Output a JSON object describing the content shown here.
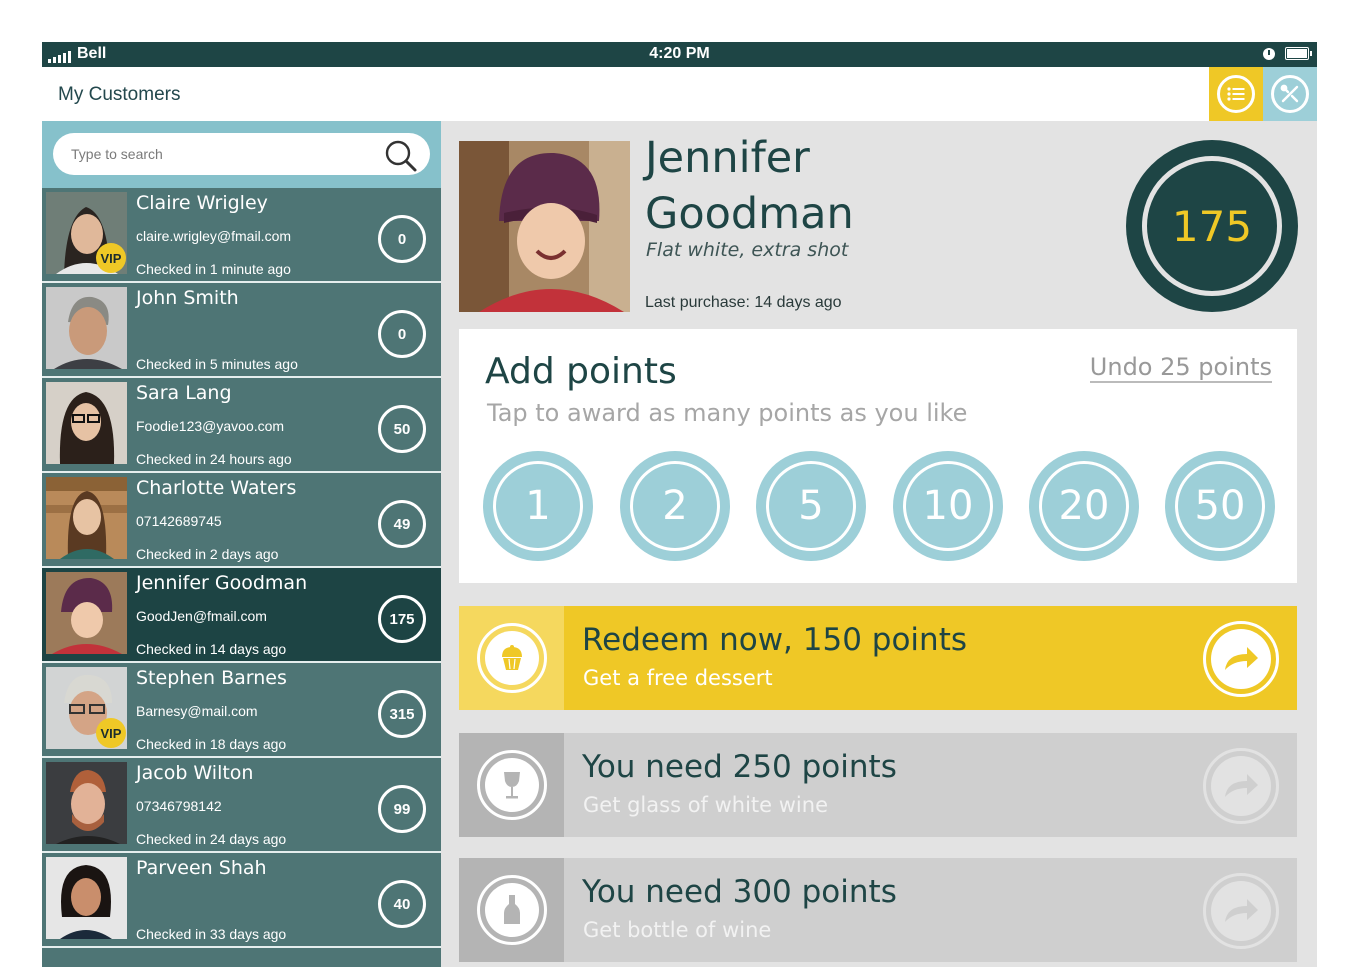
{
  "status_bar": {
    "carrier": "Bell",
    "time": "4:20 PM"
  },
  "nav": {
    "title": "My Customers",
    "list_icon": "list-icon",
    "tools_icon": "tools-icon"
  },
  "search": {
    "placeholder": "Type to search",
    "icon": "search-icon"
  },
  "customers": [
    {
      "name": "Claire Wrigley",
      "contact": "claire.wrigley@fmail.com",
      "checked": "Checked in 1 minute ago",
      "points": "0",
      "vip": "VIP"
    },
    {
      "name": "John Smith",
      "contact": "",
      "checked": "Checked in 5 minutes ago",
      "points": "0"
    },
    {
      "name": "Sara Lang",
      "contact": "Foodie123@yavoo.com",
      "checked": "Checked in 24 hours ago",
      "points": "50"
    },
    {
      "name": "Charlotte Waters",
      "contact": "07142689745",
      "checked": "Checked in 2 days ago",
      "points": "49"
    },
    {
      "name": "Jennifer Goodman",
      "contact": "GoodJen@fmail.com",
      "checked": "Checked in 14 days ago",
      "points": "175",
      "active": true
    },
    {
      "name": "Stephen Barnes",
      "contact": "Barnesy@mail.com",
      "checked": "Checked in 18 days ago",
      "points": "315",
      "vip": "VIP"
    },
    {
      "name": "Jacob Wilton",
      "contact": "07346798142",
      "checked": "Checked in 24 days ago",
      "points": "99"
    },
    {
      "name": "Parveen Shah",
      "contact": "",
      "checked": "Checked in 33 days ago",
      "points": "40"
    }
  ],
  "profile": {
    "first_name": "Jennifer",
    "last_name": "Goodman",
    "note": "Flat white, extra shot",
    "last_purchase": "Last purchase: 14 days ago",
    "points": "175"
  },
  "add_points": {
    "title": "Add points",
    "subtitle": "Tap to award as many points as you like",
    "undo": "Undo 25 points",
    "buttons": [
      "1",
      "2",
      "5",
      "10",
      "20",
      "50"
    ]
  },
  "rewards": [
    {
      "title": "Redeem now, 150 points",
      "subtitle": "Get a free dessert",
      "icon": "cupcake-icon",
      "available": true
    },
    {
      "title": "You need 250 points",
      "subtitle": "Get glass of white wine",
      "icon": "wine-glass-icon",
      "available": false
    },
    {
      "title": "You need 300 points",
      "subtitle": "Get bottle of wine",
      "icon": "wine-bottle-icon",
      "available": false
    }
  ],
  "colors": {
    "dark_teal": "#1e4545",
    "teal": "#4e7575",
    "light_blue": "#9dcfd8",
    "gold": "#efc826",
    "grey": "#cfcfcf"
  }
}
